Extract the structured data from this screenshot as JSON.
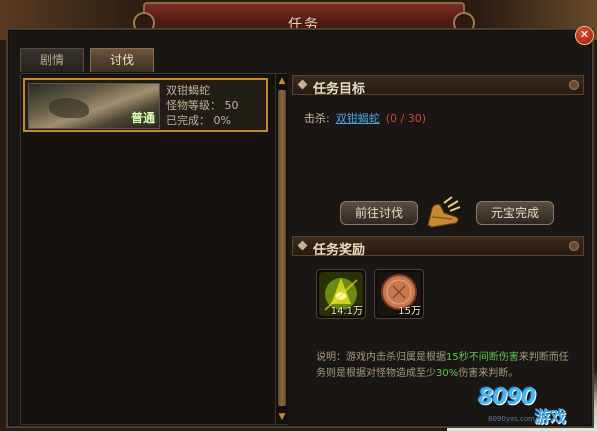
{
  "window": {
    "title": "任务",
    "close_glyph": "✕"
  },
  "tabs": [
    {
      "label": "剧情",
      "active": false
    },
    {
      "label": "讨伐",
      "active": true
    }
  ],
  "quest_list": [
    {
      "name": "双钳蝎蛇",
      "level_label": "怪物等级：",
      "level": "50",
      "complete_label": "已完成：",
      "complete": "0%",
      "difficulty": "普通"
    }
  ],
  "objective": {
    "header": "任务目标",
    "kill_label": "击杀:",
    "target": "双钳蝎蛇",
    "progress": "(0 / 30)"
  },
  "buttons": {
    "go_hunt": "前往讨伐",
    "ingot_complete": "元宝完成"
  },
  "rewards": {
    "header": "任务奖励",
    "items": [
      {
        "icon": "experience-icon",
        "quantity": "14.1万"
      },
      {
        "icon": "copper-coin-icon",
        "quantity": "15万"
      }
    ]
  },
  "note": {
    "prefix": "说明：游戏内击杀归属是根据",
    "hl1": "15秒不间断伤害",
    "mid": "来判断而任务则是根据对怪物造成至少",
    "hl2": "30%",
    "suffix": "伤害来判断。"
  },
  "watermark": {
    "logo": "8090",
    "brand": "游戏",
    "url": "8090yxs.com"
  },
  "colors": {
    "accent_gold": "#c48a2a",
    "link_blue": "#4aa8e8",
    "progress_red": "#c84a3a",
    "highlight_green": "#5ac84a"
  }
}
